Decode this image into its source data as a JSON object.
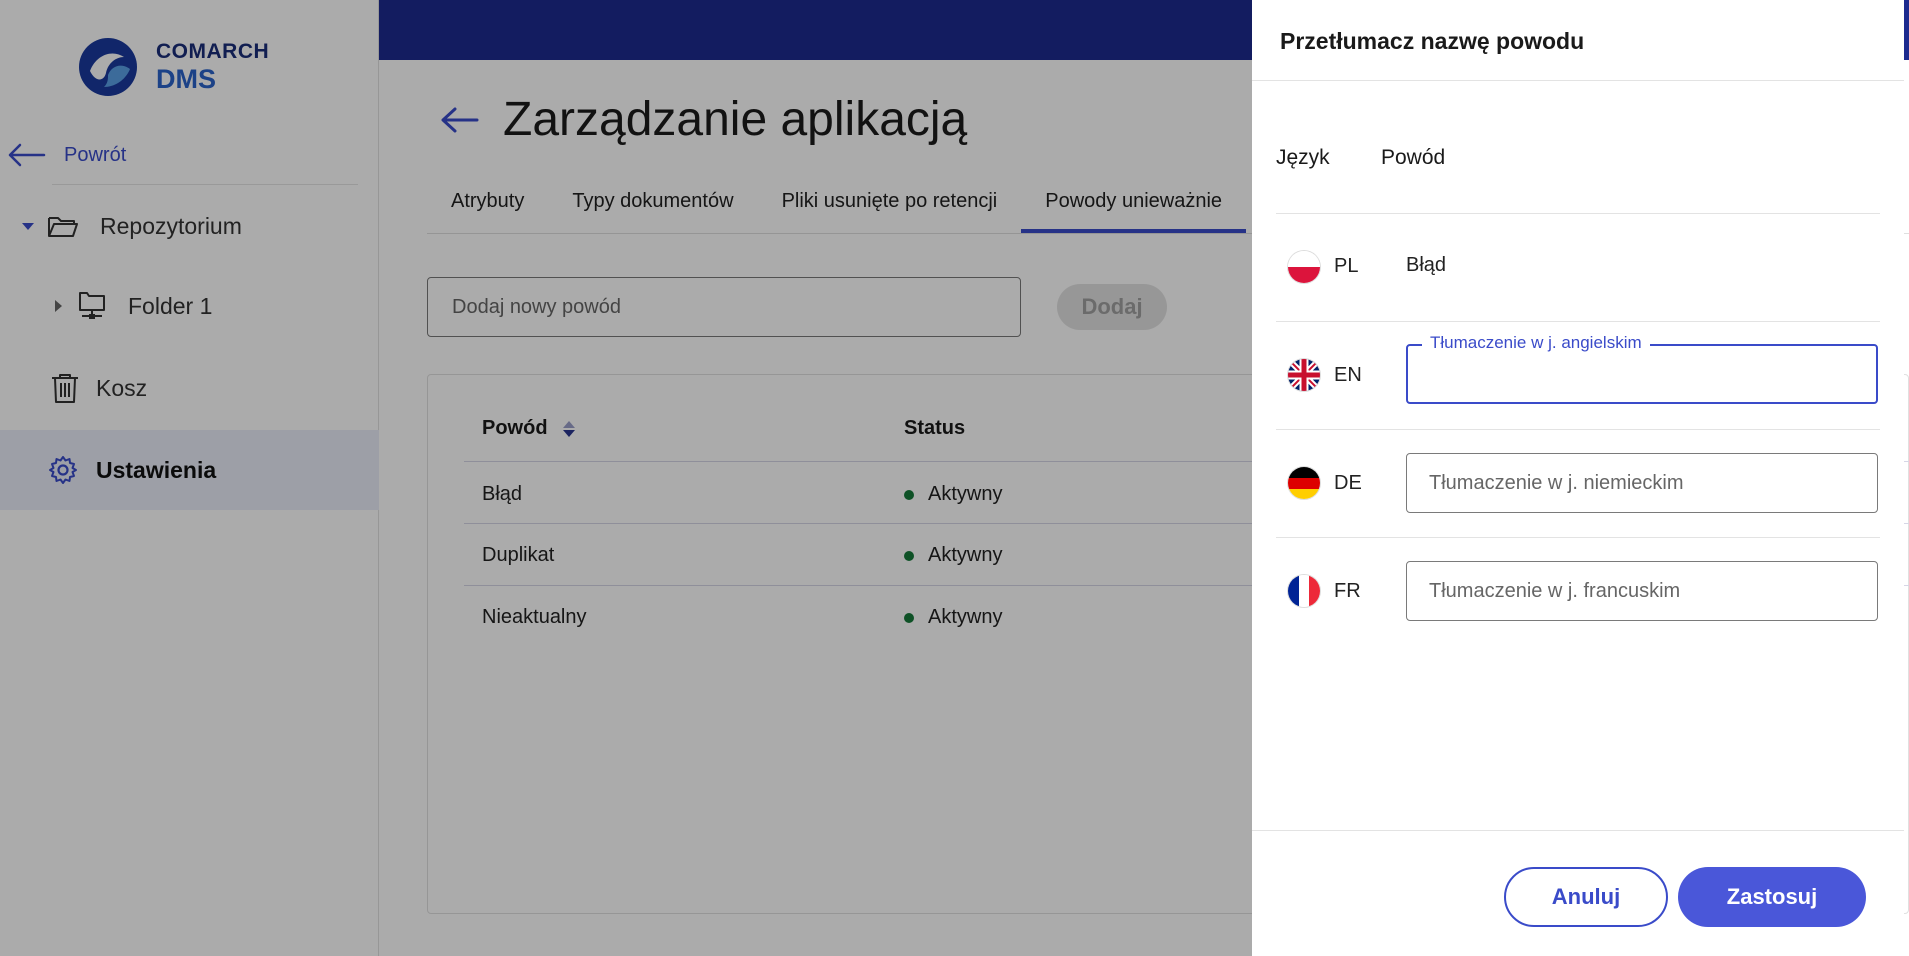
{
  "brand": {
    "line1": "COMARCH",
    "line2": "DMS"
  },
  "sidebar": {
    "back_label": "Powrót",
    "repository_label": "Repozytorium",
    "folder_label": "Folder 1",
    "trash_label": "Kosz",
    "settings_label": "Ustawienia"
  },
  "main": {
    "page_title": "Zarządzanie aplikacją",
    "tabs": [
      {
        "label": "Atrybuty"
      },
      {
        "label": "Typy dokumentów"
      },
      {
        "label": "Pliki usunięte po retencji"
      },
      {
        "label": "Powody unieważnie"
      }
    ],
    "active_tab": 3,
    "add_placeholder": "Dodaj nowy powód",
    "add_button": "Dodaj",
    "table": {
      "headers": {
        "reason": "Powód",
        "status": "Status"
      },
      "rows": [
        {
          "reason": "Błąd",
          "status": "Aktywny"
        },
        {
          "reason": "Duplikat",
          "status": "Aktywny"
        },
        {
          "reason": "Nieaktualny",
          "status": "Aktywny"
        }
      ]
    }
  },
  "dialog": {
    "title": "Przetłumacz nazwę powodu",
    "col_language": "Język",
    "col_reason": "Powód",
    "languages": [
      {
        "code": "PL",
        "value": "Błąd"
      },
      {
        "code": "EN",
        "label": "Tłumaczenie w j. angielskim",
        "value": ""
      },
      {
        "code": "DE",
        "placeholder": "Tłumaczenie w j. niemieckim",
        "value": ""
      },
      {
        "code": "FR",
        "placeholder": "Tłumaczenie w j. francuskim",
        "value": ""
      }
    ],
    "cancel_label": "Anuluj",
    "apply_label": "Zastosuj"
  },
  "colors": {
    "primary": "#3a4bc9",
    "topbar": "#1d2b8f",
    "status_active": "#157a3a"
  }
}
